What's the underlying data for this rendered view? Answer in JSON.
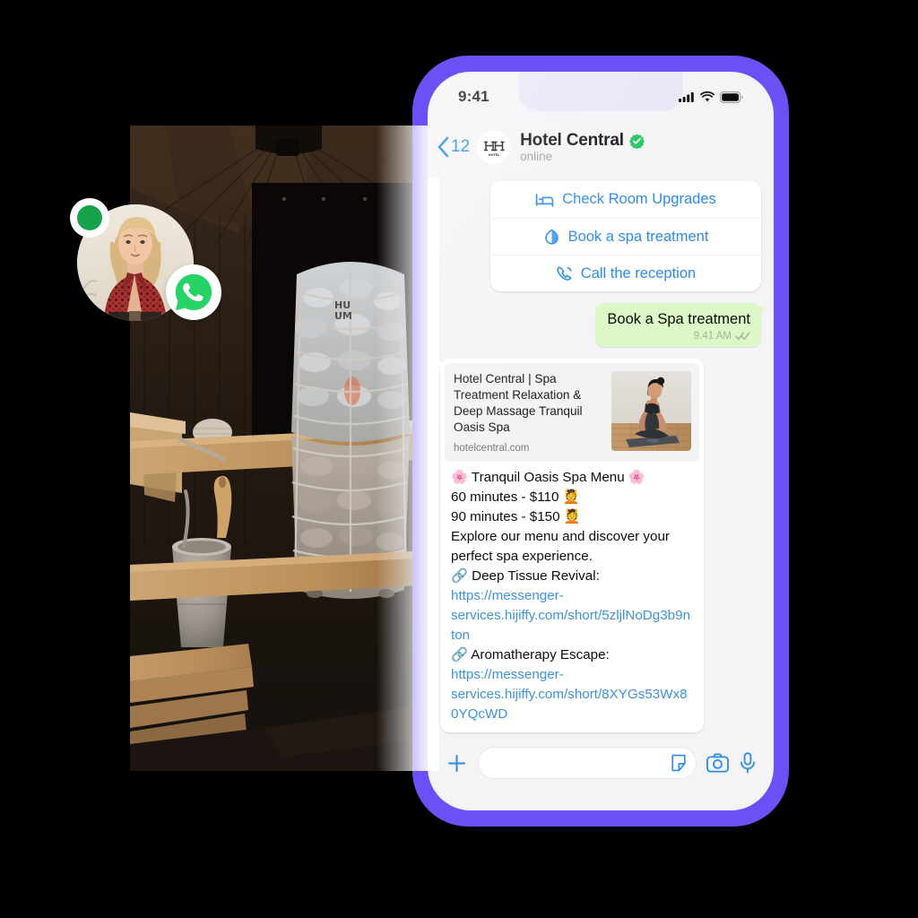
{
  "theme": {
    "phone_frame_color": "#6C4FF5",
    "screen_bg": "#F4F3F5",
    "notch_color": "#E8E6F7",
    "accent_blue": "#2A8BEA",
    "link_blue": "#3B92E0",
    "outgoing_bubble": "#DCF8C6",
    "online_green": "#16A34A",
    "verified_green": "#22C55E"
  },
  "status_bar": {
    "time": "9:41",
    "icons": [
      "cellular-signal-icon",
      "wifi-icon",
      "battery-icon"
    ]
  },
  "chat_header": {
    "back_icon": "chevron-left-icon",
    "back_count": "12",
    "avatar_icon": "hotel-beds-icon",
    "title": "Hotel Central",
    "verified_icon": "verified-badge-icon",
    "status": "online"
  },
  "quick_replies": [
    {
      "icon": "bed-icon",
      "label": "Check Room Upgrades"
    },
    {
      "icon": "spa-leaf-icon",
      "label": "Book a spa treatment"
    },
    {
      "icon": "phone-call-icon",
      "label": "Call the reception"
    }
  ],
  "outgoing_message": {
    "text": "Book a Spa treatment",
    "time": "9.41 AM",
    "status_icon": "double-check-icon"
  },
  "incoming_message": {
    "preview": {
      "title": "Hotel Central | Spa Treatment Relaxation & Deep Massage Tranquil Oasis Spa",
      "domain": "hotelcentral.com",
      "thumbnail_icon": "meditating-woman-photo"
    },
    "body_lines": [
      {
        "type": "text",
        "text": "🌸 Tranquil Oasis Spa Menu 🌸"
      },
      {
        "type": "text",
        "text": "60 minutes - $110 💆"
      },
      {
        "type": "text",
        "text": "90 minutes - $150 💆"
      },
      {
        "type": "text",
        "text": "Explore our menu and discover your perfect spa experience."
      },
      {
        "type": "link",
        "prefix": "🔗 Deep Tissue Revival: ",
        "url": "https://messenger-services.hijiffy.com/short/5zljlNoDg3b9nton"
      },
      {
        "type": "link",
        "prefix": "🔗 Aromatherapy Escape: ",
        "url": "https://messenger-services.hijiffy.com/short/8XYGs53Wx80YQcWD"
      }
    ]
  },
  "input_bar": {
    "plus_icon": "plus-icon",
    "placeholder": "",
    "value": "",
    "sticker_icon": "sticker-icon",
    "camera_icon": "camera-icon",
    "mic_icon": "microphone-icon"
  },
  "side_media": {
    "photo_alt": "sauna-interior-photo",
    "avatar_alt": "woman-avatar-photo",
    "online_indicator": "online-status-dot",
    "channel_badge": "whatsapp-icon"
  }
}
